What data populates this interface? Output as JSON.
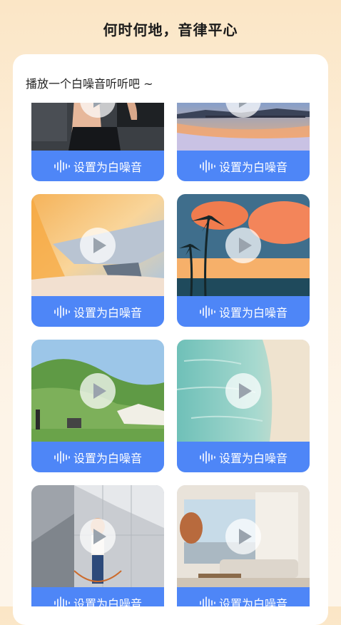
{
  "header": {
    "title": "何时何地，音律平心"
  },
  "panel": {
    "heading": "播放一个白噪音听听吧 ~"
  },
  "cards": [
    {
      "scene": "gym",
      "action_label": "设置为白噪音"
    },
    {
      "scene": "lake-pier",
      "action_label": "设置为白噪音"
    },
    {
      "scene": "airplane-wing",
      "action_label": "设置为白噪音"
    },
    {
      "scene": "palm-sunset",
      "action_label": "设置为白噪音"
    },
    {
      "scene": "meadow-camping",
      "action_label": "设置为白噪音"
    },
    {
      "scene": "sea-shore",
      "action_label": "设置为白噪音"
    },
    {
      "scene": "jump-rope-concrete",
      "action_label": "设置为白噪音"
    },
    {
      "scene": "living-room",
      "action_label": "设置为白噪音"
    }
  ],
  "icons": {
    "play": "play-icon",
    "sound_wave": "sound-wave-icon"
  },
  "colors": {
    "accent": "#4e86f7",
    "background": "#fbe6c6"
  }
}
